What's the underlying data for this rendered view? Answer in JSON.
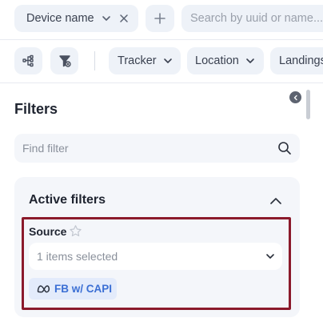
{
  "toolbar": {
    "device_name_chip": "Device name",
    "search_placeholder": "Search by uuid or name...",
    "filters": [
      "Tracker",
      "Location",
      "Landings"
    ]
  },
  "filters_panel": {
    "title": "Filters",
    "find_placeholder": "Find filter",
    "active_filters_title": "Active filters",
    "source": {
      "label": "Source",
      "select_value": "1 items selected",
      "tag": "FB w/ CAPI"
    }
  },
  "colors": {
    "accent_highlight": "#8b1a2b",
    "tag_bg": "#e3ebfb",
    "tag_text": "#3b6fd4"
  }
}
